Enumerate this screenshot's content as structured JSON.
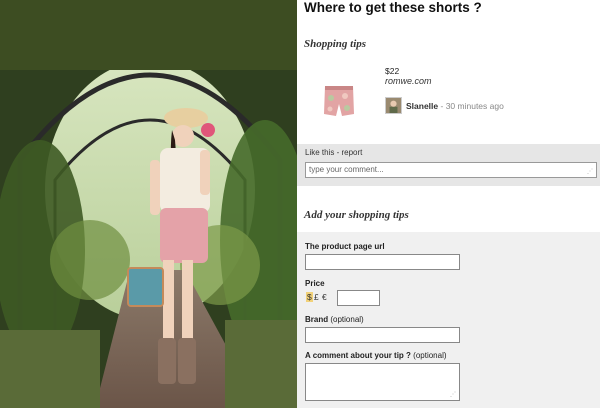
{
  "page": {
    "title": "Where to get these shorts ?"
  },
  "shopping_tips": {
    "heading": "Shopping tips",
    "item": {
      "price": "$22",
      "shop": "romwe.com",
      "user": "Slanelle",
      "time": "- 30 minutes ago"
    },
    "like_report": "Like this - report",
    "comment_placeholder": "type your comment..."
  },
  "add_tips": {
    "heading": "Add your shopping tips",
    "url_label": "The product page url",
    "price_label": "Price",
    "currencies": [
      "$",
      "£",
      "€"
    ],
    "selected_currency": "$",
    "brand_label": "Brand",
    "brand_optional": "(optional)",
    "comment_label": "A comment about your tip ?",
    "comment_optional": "(optional)"
  },
  "colors": {
    "form_bg": "#f0f0f0",
    "like_bar_bg": "#e6e6e6",
    "currency_highlight": "#f2d27a"
  },
  "icons": [
    "resize-grip-icon"
  ]
}
